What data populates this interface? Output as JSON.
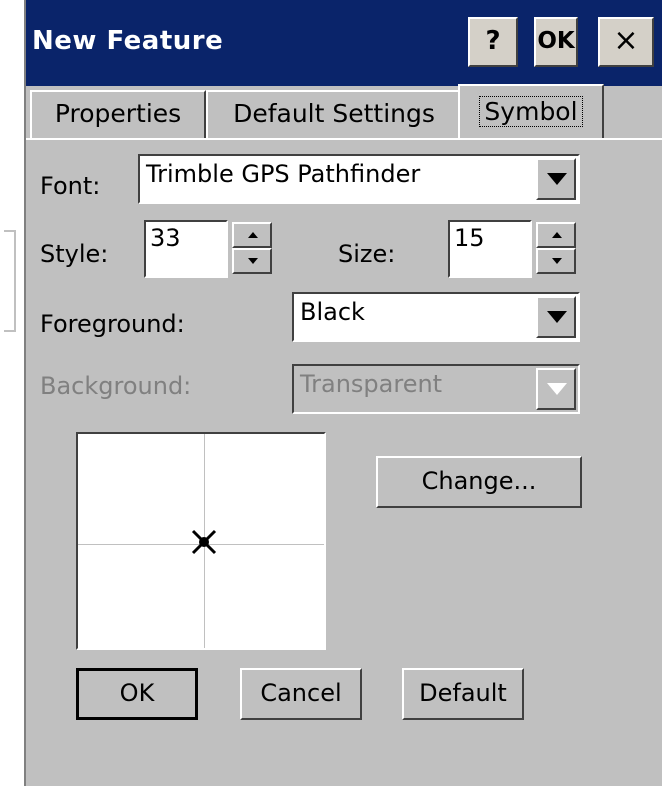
{
  "window": {
    "title": "New Feature",
    "help_label": "?",
    "ok_label": "OK",
    "close_label": "×"
  },
  "tabs": [
    {
      "label": "Properties",
      "active": false
    },
    {
      "label": "Default Settings",
      "active": false
    },
    {
      "label": "Symbol",
      "active": true
    }
  ],
  "symbol": {
    "font_label": "Font:",
    "font_value": "Trimble GPS Pathfinder",
    "style_label": "Style:",
    "style_value": "33",
    "size_label": "Size:",
    "size_value": "15",
    "foreground_label": "Foreground:",
    "foreground_value": "Black",
    "background_label": "Background:",
    "background_value": "Transparent",
    "change_label": "Change..."
  },
  "buttons": {
    "ok": "OK",
    "cancel": "Cancel",
    "default": "Default"
  },
  "colors": {
    "titlebar": "#0a246a",
    "face": "#c0c0c0"
  }
}
